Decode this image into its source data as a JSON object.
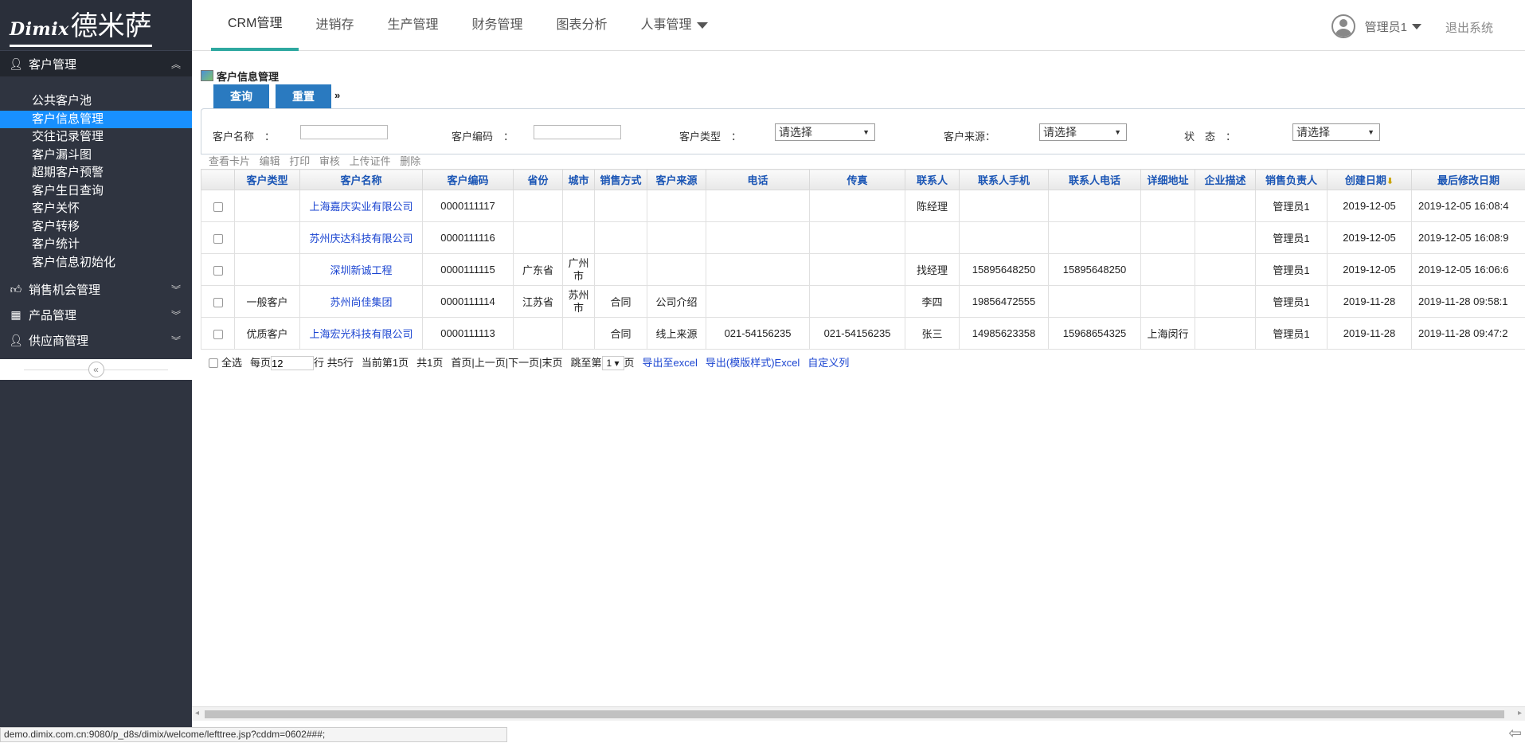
{
  "brand": {
    "latin": "Dimix",
    "cn": "德米萨"
  },
  "sidebar": {
    "sections": [
      {
        "label": "客户管理",
        "icon": "user-icon",
        "expanded": true
      },
      {
        "label": "销售机会管理",
        "icon": "thumbs-up-icon"
      },
      {
        "label": "产品管理",
        "icon": "grid-icon"
      },
      {
        "label": "供应商管理",
        "icon": "user-icon"
      }
    ],
    "items": [
      "公共客户池",
      "客户信息管理",
      "交往记录管理",
      "客户漏斗图",
      "超期客户预警",
      "客户生日查询",
      "客户关怀",
      "客户转移",
      "客户统计",
      "客户信息初始化"
    ],
    "active_item": "客户信息管理"
  },
  "topnav": {
    "tabs": [
      "CRM管理",
      "进销存",
      "生产管理",
      "财务管理",
      "图表分析",
      "人事管理"
    ],
    "active": "CRM管理",
    "user": "管理员1",
    "logout": "退出系统"
  },
  "page": {
    "title": "客户信息管理",
    "query_label": "查询",
    "reset_label": "重置",
    "filters": {
      "name_label": "客户名称　：",
      "code_label": "客户编码　：",
      "type_label": "客户类型　：",
      "source_label": "客户来源：",
      "status_label": "状　态　：",
      "select_placeholder": "请选择"
    },
    "actions": [
      "查看卡片",
      "编辑",
      "打印",
      "审核",
      "上传证件",
      "删除"
    ],
    "columns": [
      "客户类型",
      "客户名称",
      "客户编码",
      "省份",
      "城市",
      "销售方式",
      "客户来源",
      "电话",
      "传真",
      "联系人",
      "联系人手机",
      "联系人电话",
      "详细地址",
      "企业描述",
      "销售负责人",
      "创建日期",
      "最后修改日期"
    ],
    "rows": [
      {
        "type": "",
        "name": "上海嘉庆实业有限公司",
        "code": "0000111117",
        "province": "",
        "city": "",
        "sales_mode": "",
        "source": "",
        "phone": "",
        "fax": "",
        "contact": "陈经理",
        "mobile": "",
        "contact_phone": "",
        "address": "",
        "desc": "",
        "owner": "管理员1",
        "created": "2019-12-05",
        "modified": "2019-12-05 16:08:4"
      },
      {
        "type": "",
        "name": "苏州庆达科技有限公司",
        "code": "0000111116",
        "province": "",
        "city": "",
        "sales_mode": "",
        "source": "",
        "phone": "",
        "fax": "",
        "contact": "",
        "mobile": "",
        "contact_phone": "",
        "address": "",
        "desc": "",
        "owner": "管理员1",
        "created": "2019-12-05",
        "modified": "2019-12-05 16:08:9"
      },
      {
        "type": "",
        "name": "深圳新诚工程",
        "code": "0000111115",
        "province": "广东省",
        "city": "广州市",
        "sales_mode": "",
        "source": "",
        "phone": "",
        "fax": "",
        "contact": "找经理",
        "mobile": "15895648250",
        "contact_phone": "15895648250",
        "address": "",
        "desc": "",
        "owner": "管理员1",
        "created": "2019-12-05",
        "modified": "2019-12-05 16:06:6"
      },
      {
        "type": "一般客户",
        "name": "苏州尚佳集团",
        "code": "0000111114",
        "province": "江苏省",
        "city": "苏州市",
        "sales_mode": "合同",
        "source": "公司介绍",
        "phone": "",
        "fax": "",
        "contact": "李四",
        "mobile": "19856472555",
        "contact_phone": "",
        "address": "",
        "desc": "",
        "owner": "管理员1",
        "created": "2019-11-28",
        "modified": "2019-11-28 09:58:1"
      },
      {
        "type": "优质客户",
        "name": "上海宏光科技有限公司",
        "code": "0000111113",
        "province": "",
        "city": "",
        "sales_mode": "合同",
        "source": "线上来源",
        "phone": "021-54156235",
        "fax": "021-54156235",
        "contact": "张三",
        "mobile": "14985623358",
        "contact_phone": "15968654325",
        "address": "上海闵行",
        "desc": "",
        "owner": "管理员1",
        "created": "2019-11-28",
        "modified": "2019-11-28 09:47:2"
      }
    ],
    "pager": {
      "select_all": "全选",
      "per_page_prefix": "每页",
      "per_page_value": "12",
      "per_page_suffix": "行 共5行",
      "current": "当前第1页",
      "total": "共1页",
      "nav": "首页|上一页|下一页|末页",
      "jump_prefix": "跳至第",
      "jump_value": "1",
      "jump_suffix": "页",
      "export_excel": "导出至excel",
      "export_template": "导出(模版样式)Excel",
      "custom_columns": "自定义列"
    }
  },
  "statusbar": "demo.dimix.com.cn:9080/p_d8s/dimix/welcome/lefttree.jsp?cddm=0602###;"
}
